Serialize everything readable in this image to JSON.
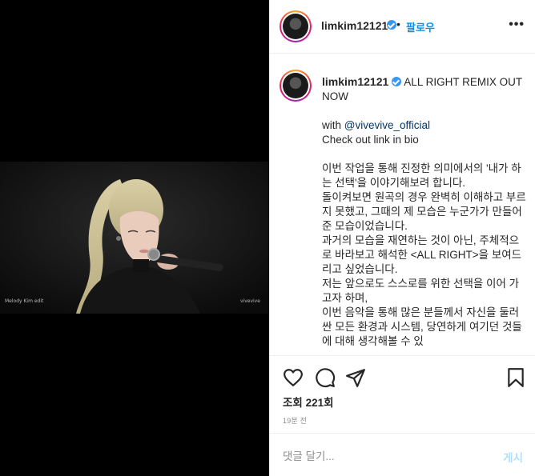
{
  "post": {
    "username": "limkim12121",
    "follow_label": "팔로우",
    "separator": "•",
    "more_label": "•••",
    "caption_title": " ALL RIGHT REMIX OUT NOW",
    "caption_lines": [
      "with ",
      "Check out link in bio"
    ],
    "mention": "@vivevive_official",
    "body_paragraph": "이번 작업을 통해 진정한 의미에서의 '내가 하는 선택'을 이야기해보려 합니다.",
    "body_lines": [
      "돌이켜보면 원곡의 경우 완벽히 이해하고 부르지 못했고, 그때의 제 모습은 누군가가 만들어 준 모습이었습니다.",
      "과거의 모습을 재연하는 것이 아닌, 주체적으로 바라보고 해석한 <ALL RIGHT>을 보여드리고 싶었습니다.",
      "저는 앞으로도 스스로를 위한 선택을 이어 가고자 하며,",
      "이번 음악을 통해 많은 분들께서 자신을 둘러싼 모든 환경과 시스템, 당연하게 여기던 것들에 대해 생각해볼 수 있"
    ],
    "views": "조회 221회",
    "time_ago": "19분 전",
    "comment_placeholder": "댓글 달기...",
    "post_label": "게시"
  },
  "video": {
    "watermark_left": "Melody Kim edit",
    "watermark_right": "vivevive"
  },
  "icons": {
    "like": "heart-icon",
    "comment": "comment-bubble-icon",
    "share": "paper-plane-icon",
    "save": "bookmark-icon",
    "verified": "verified-badge-icon"
  },
  "colors": {
    "follow": "#0095f6",
    "verified": "#3897f0",
    "post_disabled": "#b2dffc",
    "mention": "#00376b"
  }
}
